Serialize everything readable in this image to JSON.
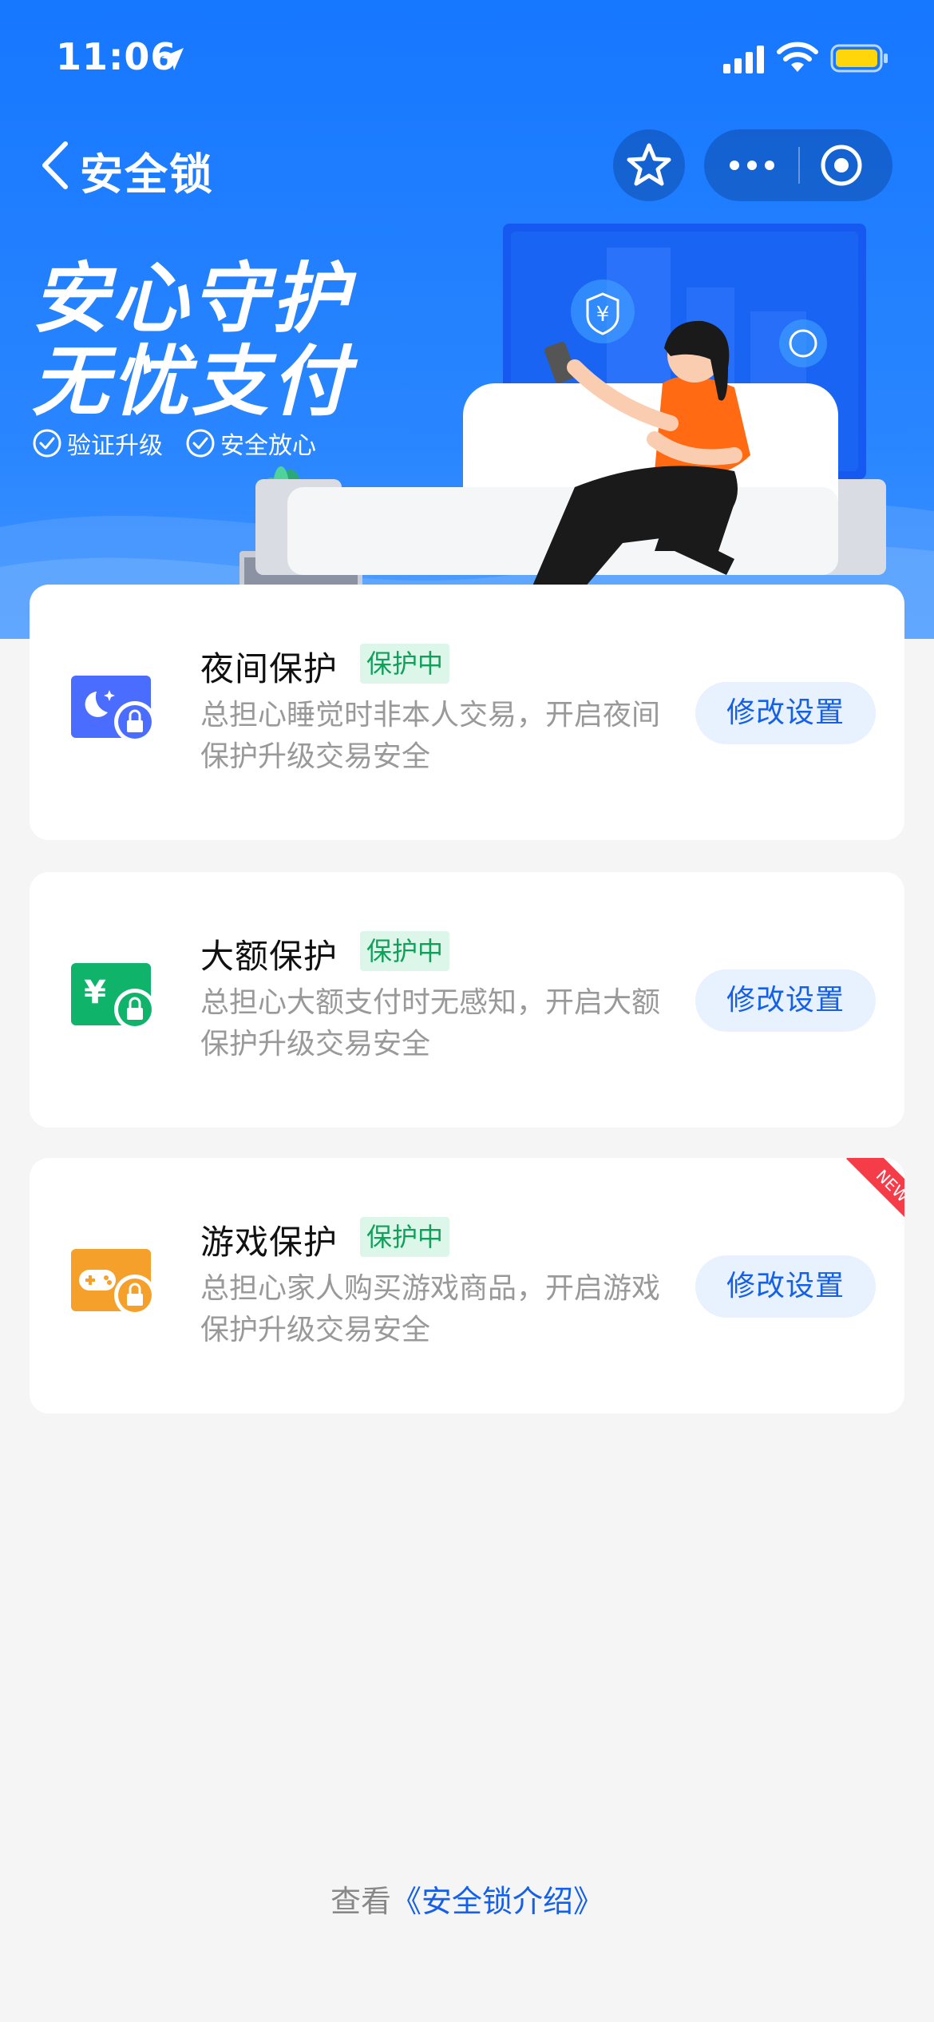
{
  "status_bar": {
    "time": "11:06",
    "icons": [
      "location-arrow-icon",
      "cellular-signal-icon",
      "wifi-icon",
      "battery-icon"
    ]
  },
  "nav": {
    "title": "安全锁",
    "icons": [
      "back-chevron-icon",
      "star-icon",
      "more-dots-icon",
      "close-target-icon"
    ]
  },
  "hero": {
    "line1": "安心守护",
    "line2": "无忧支付",
    "tags": [
      "验证升级",
      "安全放心"
    ]
  },
  "cards": [
    {
      "title": "夜间保护",
      "badge": "保护中",
      "description": "总担心睡觉时非本人交易，开启夜间保护升级交易安全",
      "button": "修改设置",
      "icon": "night-lock-icon",
      "icon_color": "#4a6cff"
    },
    {
      "title": "大额保护",
      "badge": "保护中",
      "description": "总担心大额支付时无感知，开启大额保护升级交易安全",
      "button": "修改设置",
      "icon": "yuan-lock-icon",
      "icon_color": "#0fb36a"
    },
    {
      "title": "游戏保护",
      "badge": "保护中",
      "description": "总担心家人购买游戏商品，开启游戏保护升级交易安全",
      "button": "修改设置",
      "icon": "gamepad-lock-icon",
      "icon_color": "#f5a02a",
      "ribbon": "NEW"
    }
  ],
  "footer": {
    "prefix": "查看",
    "link": "《安全锁介绍》"
  },
  "colors": {
    "brand_blue": "#1677ff",
    "badge_green": "#10a05a",
    "button_text": "#1560e8",
    "ribbon_red": "#f53d4a"
  }
}
